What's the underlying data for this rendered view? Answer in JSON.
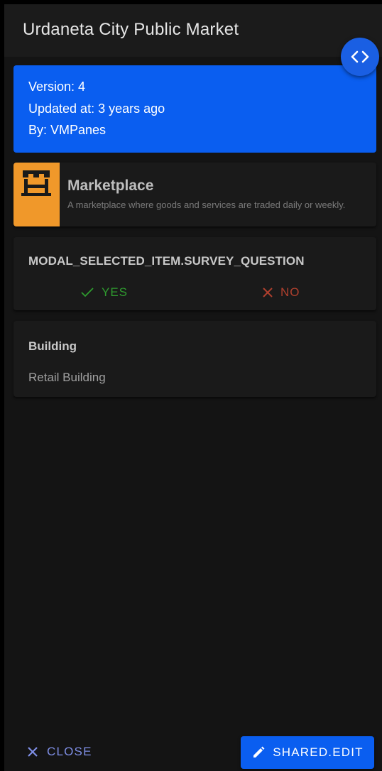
{
  "header": {
    "title": "Urdaneta City Public Market"
  },
  "code_button": {
    "icon": "code-icon"
  },
  "version_info": {
    "version": "Version: 4",
    "updated": "Updated at: 3 years ago",
    "by": "By: VMPanes"
  },
  "category": {
    "icon": "marketplace-icon",
    "icon_bg_color": "#f0982a",
    "name": "Marketplace",
    "description": "A marketplace where goods and services are traded daily or weekly."
  },
  "survey": {
    "question": "MODAL_SELECTED_ITEM.SURVEY_QUESTION",
    "yes_label": "YES",
    "no_label": "NO",
    "yes_color": "#2f9c2f",
    "no_color": "#b0402e"
  },
  "building": {
    "label": "Building",
    "value": "Retail Building"
  },
  "footer": {
    "close_label": "CLOSE",
    "edit_label": "SHARED.EDIT",
    "accent_color": "#0a5ef0"
  }
}
